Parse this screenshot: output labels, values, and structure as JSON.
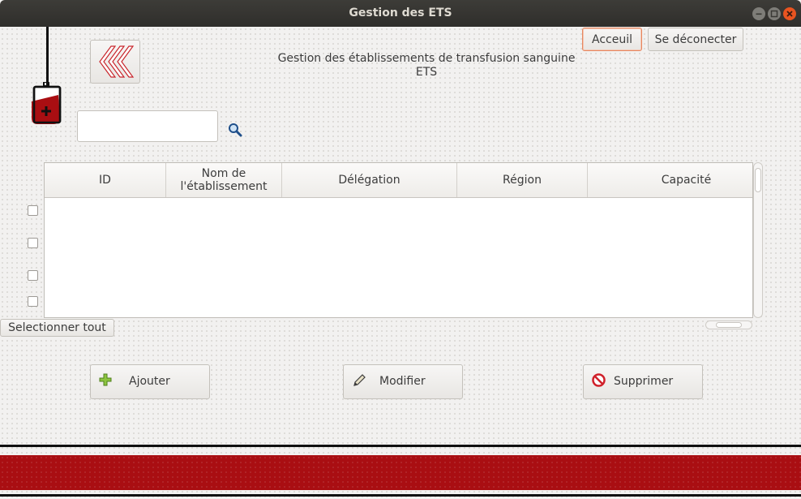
{
  "window": {
    "title": "Gestion des ETS",
    "controls": {
      "minimize_icon": "minimize-icon",
      "maximize_icon": "maximize-icon",
      "close_icon": "close-icon"
    }
  },
  "header": {
    "back_icon": "chevrons-left-icon",
    "logo_icon": "blood-bag-icon",
    "accueil_label": "Acceuil",
    "logout_label": "Se déconecter",
    "subtitle_line1": "Gestion des établissements de transfusion sanguine",
    "subtitle_line2": "ETS"
  },
  "search": {
    "value": "",
    "placeholder": "",
    "icon": "search-icon"
  },
  "table": {
    "columns": [
      "ID",
      "Nom de\nl'établissement",
      "Délégation",
      "Région",
      "Capacité"
    ],
    "rows": []
  },
  "select_all_label": "Selectionner tout",
  "actions": {
    "add_label": "Ajouter",
    "edit_label": "Modifier",
    "delete_label": "Supprimer"
  },
  "colors": {
    "accent": "#e95420",
    "brand_red": "#a90e12",
    "focus_border": "#e6865f"
  }
}
